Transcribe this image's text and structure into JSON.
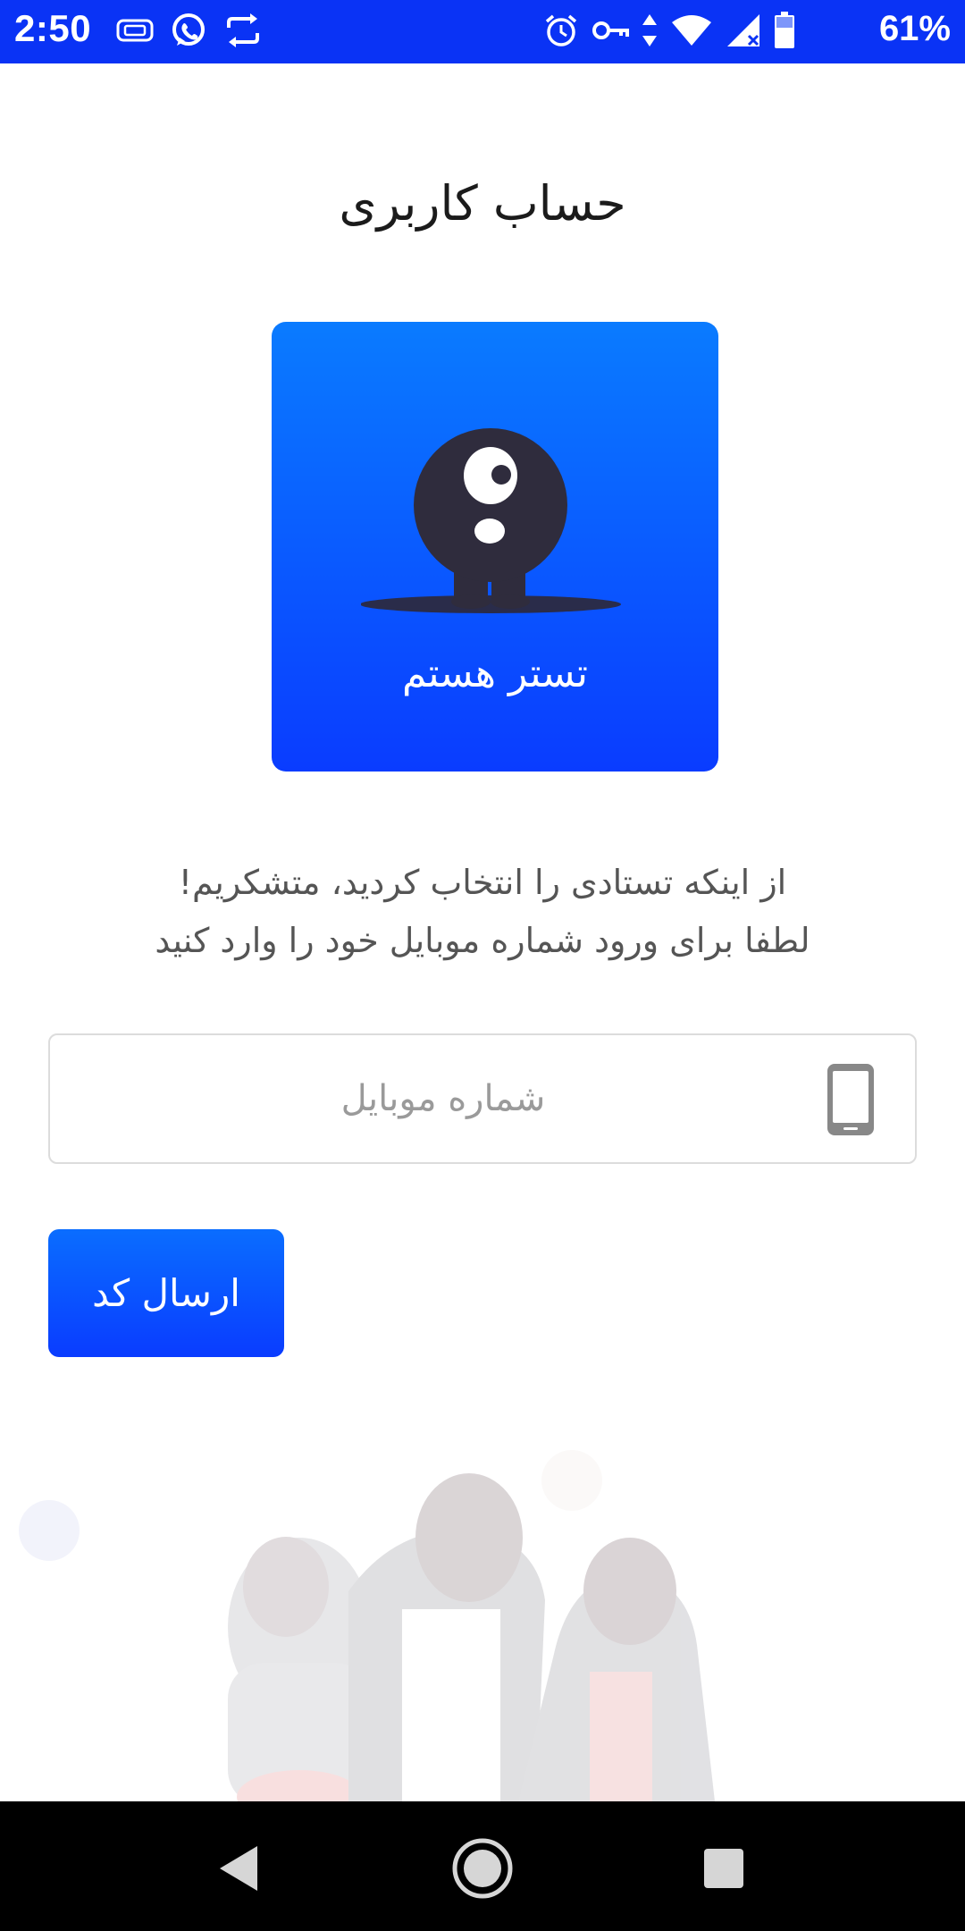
{
  "status_bar": {
    "time": "2:50",
    "battery_percent": "61%",
    "left_icons": [
      "sim-card-icon",
      "whatsapp-icon",
      "sync-icon"
    ],
    "right_icons": [
      "alarm-icon",
      "vpn-key-icon",
      "data-arrows-icon",
      "wifi-icon",
      "signal-icon",
      "battery-icon"
    ]
  },
  "header": {
    "title": "حساب کاربری"
  },
  "role_card": {
    "label": "تستر هستم",
    "icon": "monster-character-icon",
    "gradient": [
      "#0a7bff",
      "#0a3cff"
    ]
  },
  "description": {
    "line1": "از اینکه تستادی را انتخاب کردید، متشکریم!",
    "line2": "لطفا برای ورود شماره موبایل خود را وارد کنید"
  },
  "phone_input": {
    "value": "",
    "placeholder": "شماره موبایل",
    "icon": "mobile-phone-icon"
  },
  "submit": {
    "label": "ارسال کد"
  },
  "nav_bar": {
    "items": [
      "back-icon",
      "home-icon",
      "recents-icon"
    ]
  },
  "colors": {
    "accent": "#0a3cff",
    "status_bar": "#0a33f5",
    "nav_bar": "#000000"
  }
}
